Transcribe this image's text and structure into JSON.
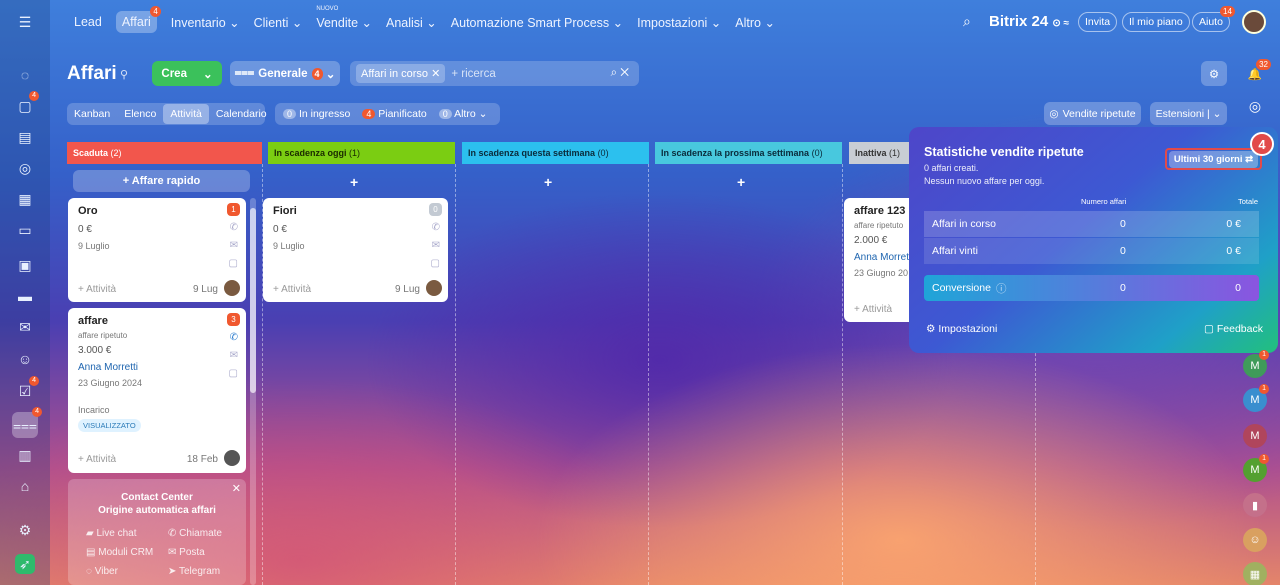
{
  "top_nav": {
    "items": [
      "Lead",
      "Affari",
      "Inventario",
      "Clienti",
      "Vendite",
      "Analisi",
      "Automazione Smart Process",
      "Impostazioni",
      "Altro"
    ],
    "affari_badge": "4",
    "vendite_tag": "NUOVO",
    "logo": "Bitrix 24",
    "invite": "Invita",
    "my_plan": "Il mio piano",
    "help": "Aiuto",
    "help_badge": "14"
  },
  "sidebar": {
    "badges": [
      "4",
      "4",
      "4"
    ]
  },
  "page": {
    "title": "Affari",
    "create": "Crea",
    "pipeline": "Generale",
    "pipeline_badge": "4",
    "filter_tag": "Affari in corso",
    "search_placeholder": "+ ricerca",
    "views": [
      "Kanban",
      "Elenco",
      "Attività",
      "Calendario"
    ],
    "counters": [
      {
        "n": "0",
        "label": "In ingresso"
      },
      {
        "n": "4",
        "label": "Pianificato"
      },
      {
        "n": "0",
        "label": "Altro"
      }
    ],
    "repeat_sales": "Vendite ripetute",
    "extensions": "Estensioni",
    "notif_badge": "32"
  },
  "columns": [
    {
      "name": "Scaduta",
      "count": "(2)",
      "color": "#f2564c"
    },
    {
      "name": "In scadenza oggi",
      "count": "(1)",
      "color": "#7bcd12"
    },
    {
      "name": "In scadenza questa settimana",
      "count": "(0)",
      "color": "#2cc0ee"
    },
    {
      "name": "In scadenza la prossima settimana",
      "count": "(0)",
      "color": "#48c8de"
    },
    {
      "name": "Inattiva",
      "count": "(1)",
      "color": "#c8cdd4"
    }
  ],
  "quick_add": "+ Affare rapido",
  "cards": {
    "oro": {
      "title": "Oro",
      "amount": "0 €",
      "date": "9 Luglio",
      "activity": "+ Attività",
      "due": "9 Lug",
      "badge": "1"
    },
    "affare": {
      "title": "affare",
      "sub": "affare ripetuto",
      "amount": "3.000 €",
      "person": "Anna Morretti",
      "date": "23 Giugno 2024",
      "task": "Incarico",
      "status": "VISUALIZZATO",
      "activity": "+ Attività",
      "due": "18 Feb",
      "badge": "3"
    },
    "fiori": {
      "title": "Fiori",
      "amount": "0 €",
      "date": "9 Luglio",
      "activity": "+ Attività",
      "due": "9 Lug",
      "badge": "0"
    },
    "affare123": {
      "title": "affare 123",
      "sub": "affare ripetuto",
      "amount": "2.000 €",
      "person": "Anna Morret",
      "date": "23 Giugno 20",
      "activity": "+ Attività"
    }
  },
  "contact_center": {
    "title": "Contact Center",
    "subtitle": "Origine automatica affari",
    "items": [
      "Live chat",
      "Chiamate",
      "Moduli CRM",
      "Posta",
      "Viber",
      "Telegram"
    ]
  },
  "stats_panel": {
    "title": "Statistiche vendite ripetute",
    "line1": "0 affari creati.",
    "line2": "Nessun nuovo affare per oggi.",
    "period": "Ultimi 30 giorni",
    "step": "4",
    "col_num": "Numero affari",
    "col_total": "Totale",
    "rows": [
      {
        "label": "Affari in corso",
        "num": "0",
        "total": "0 €"
      },
      {
        "label": "Affari vinti",
        "num": "0",
        "total": "0 €"
      }
    ],
    "conversion": {
      "label": "Conversione",
      "num": "0",
      "total": "0"
    },
    "settings": "Impostazioni",
    "feedback": "Feedback"
  },
  "right_avatars": [
    {
      "letter": "M",
      "color": "#3f9b5a",
      "badge": "1"
    },
    {
      "letter": "M",
      "color": "#3a8ecf",
      "badge": "1"
    },
    {
      "letter": "M",
      "color": "#b0455c",
      "badge": ""
    },
    {
      "letter": "M",
      "color": "#54a030",
      "badge": "1"
    }
  ]
}
